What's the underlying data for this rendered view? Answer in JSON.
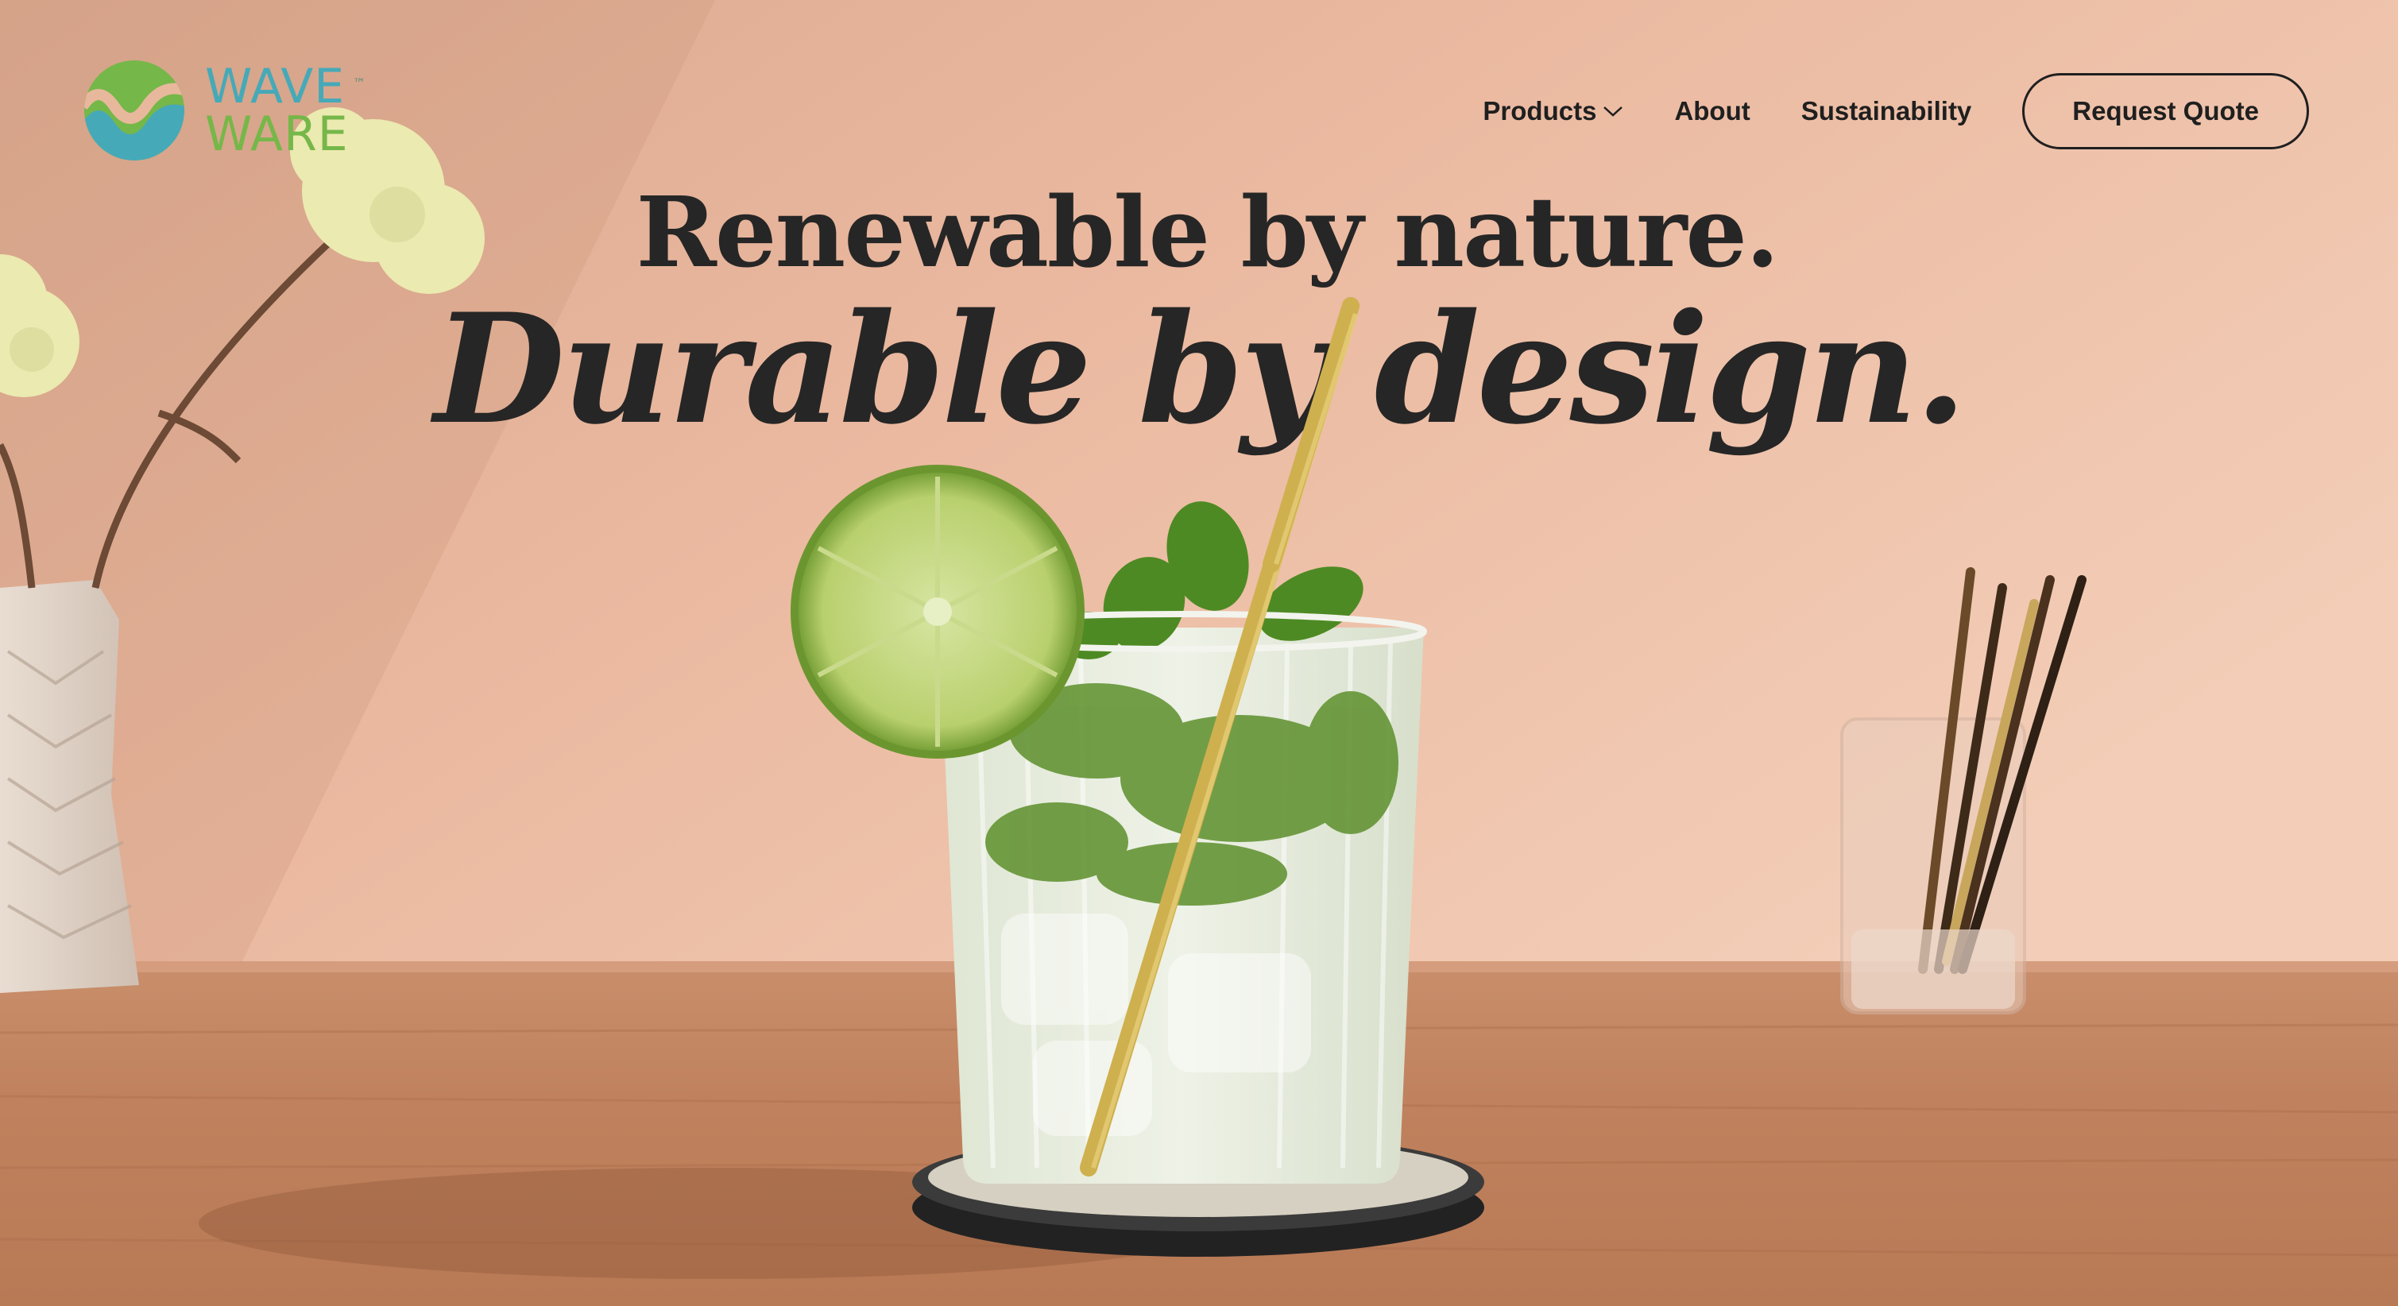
{
  "brand": {
    "name_line1": "WAVE",
    "name_line2": "WARE",
    "trademark": "™",
    "colors": {
      "teal": "#46a9b8",
      "green": "#76b749"
    }
  },
  "nav": {
    "items": [
      {
        "label": "Products",
        "has_dropdown": true
      },
      {
        "label": "About"
      },
      {
        "label": "Sustainability"
      }
    ],
    "cta_label": "Request Quote"
  },
  "hero": {
    "line1": "Renewable by nature.",
    "line2": "Durable by design."
  },
  "colors": {
    "background": "#e8b89c",
    "text": "#262626"
  }
}
